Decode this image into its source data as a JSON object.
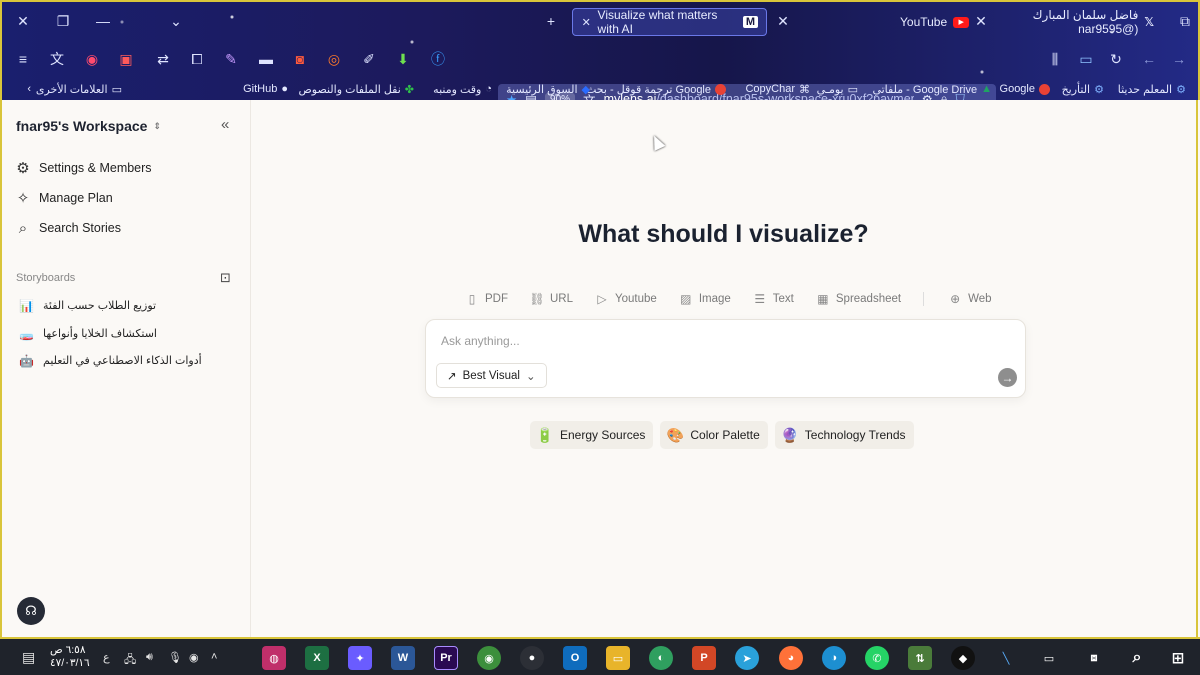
{
  "browser": {
    "tabs": [
      {
        "label": "Visualize what matters with AI",
        "active": true,
        "favicon": "mylens-logo"
      },
      {
        "label": "YouTube",
        "active": false,
        "favicon": "youtube-icon"
      },
      {
        "label": "فاضل سلمان المبارك (@nar9595",
        "active": false,
        "favicon": "x-icon"
      }
    ],
    "url": {
      "host": "mylens.ai",
      "path": "/dashboard/fnar95s-workspace-xru0xf?paymen",
      "zoom": "90%"
    },
    "bookmarks": [
      {
        "label": "المعلم حديثا",
        "icon": "gear-icon",
        "color": "#7fb2ff"
      },
      {
        "label": "التأريخ",
        "icon": "gear-icon",
        "color": "#7fb2ff"
      },
      {
        "label": "Google",
        "icon": "google-icon",
        "color": "#e94235"
      },
      {
        "label": "ملفاتي - Google Drive",
        "icon": "drive-icon",
        "color": "#1fa463"
      },
      {
        "label": "يومـي",
        "icon": "folder-icon",
        "color": "#e4e8ff"
      },
      {
        "label": "CopyChar",
        "icon": "copychar-icon",
        "color": "#ffffff"
      },
      {
        "label": "ترجمة قوقل - بحث Google",
        "icon": "google-icon",
        "color": "#e94235"
      },
      {
        "label": "السوق الرئيسية",
        "icon": "market-icon",
        "color": "#2b6cff"
      },
      {
        "label": "وقت ومنبه",
        "icon": "clock-icon",
        "color": "#ffffff"
      },
      {
        "label": "نقل الملفات والنصوص",
        "icon": "clover-icon",
        "color": "#2fc24a"
      },
      {
        "label": "GitHub",
        "icon": "github-icon",
        "color": "#ffffff"
      },
      {
        "label": "العلامات الأخرى",
        "icon": "folder-icon",
        "color": "#e4e8ff"
      }
    ]
  },
  "sidebar": {
    "workspace_name": "fnar95's Workspace",
    "nav": [
      {
        "label": "Settings & Members",
        "icon": "gear-icon"
      },
      {
        "label": "Manage Plan",
        "icon": "sparkles-icon"
      },
      {
        "label": "Search Stories",
        "icon": "search-icon"
      }
    ],
    "storyboards_label": "Storyboards",
    "stories": [
      {
        "label": "توزيع الطلاب حسب الفئة",
        "emoji": "📊"
      },
      {
        "label": "استكشاف الخلايا وأنواعها",
        "emoji": "🧫"
      },
      {
        "label": "أدوات الذكاء الاصطناعي في التعليم",
        "emoji": "🤖"
      }
    ]
  },
  "main": {
    "headline": "What should I visualize?",
    "sources": [
      {
        "label": "PDF",
        "icon": "document-icon"
      },
      {
        "label": "URL",
        "icon": "link-icon"
      },
      {
        "label": "Youtube",
        "icon": "play-icon"
      },
      {
        "label": "Image",
        "icon": "image-icon"
      },
      {
        "label": "Text",
        "icon": "text-icon"
      },
      {
        "label": "Spreadsheet",
        "icon": "spreadsheet-icon"
      },
      {
        "label": "Web",
        "icon": "globe-icon"
      }
    ],
    "ask_placeholder": "Ask anything...",
    "visual_mode": "Best Visual",
    "suggestions": [
      {
        "label": "Energy Sources",
        "emoji": "🔋"
      },
      {
        "label": "Color Palette",
        "emoji": "🎨"
      },
      {
        "label": "Technology Trends",
        "emoji": "🔮"
      }
    ]
  },
  "taskbar": {
    "time": "٦:٥٨ ص",
    "date": "٤٧/٠٣/١٦",
    "lang": "ع",
    "apps": [
      "pinned-app",
      "excel",
      "copilot",
      "word",
      "premiere",
      "chrome",
      "recorder",
      "outlook",
      "files",
      "edge-canary",
      "powerpoint",
      "telegram",
      "firefox",
      "edge",
      "whatsapp",
      "drive-sync",
      "inkscape",
      "pen-tool",
      "window",
      "task-view",
      "search",
      "start"
    ]
  }
}
